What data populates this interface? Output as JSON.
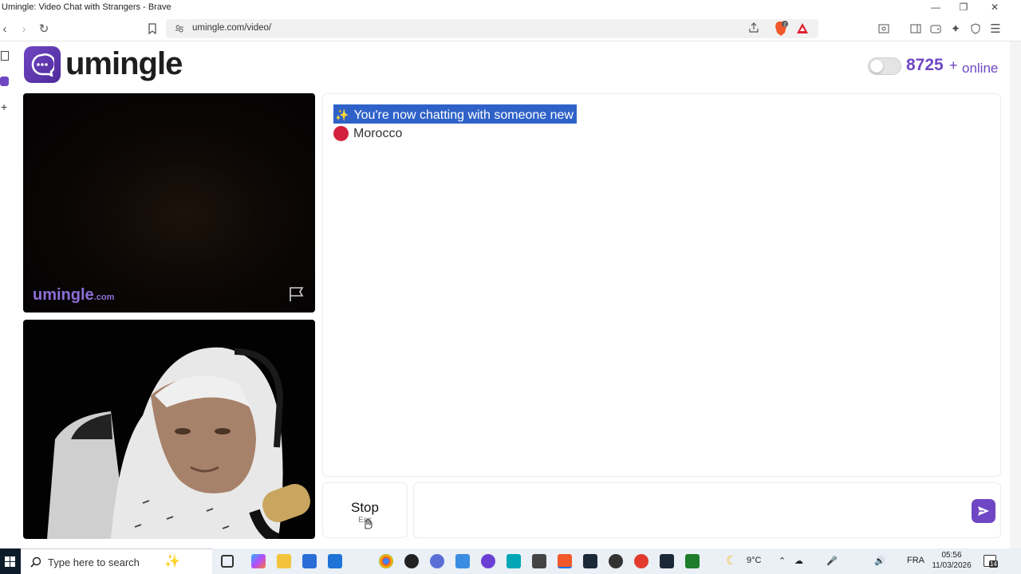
{
  "window": {
    "title": "Umingle: Video Chat with Strangers - Brave"
  },
  "browser": {
    "url": "umingle.com/video/",
    "shield_count": "2"
  },
  "header": {
    "brand": "umingle",
    "online_count": "8725",
    "online_plus": "+",
    "online_label": "online"
  },
  "video": {
    "watermark_main": "umingle",
    "watermark_suffix": ".com"
  },
  "chat": {
    "system_message": "You're now chatting with someone new",
    "country": "Morocco"
  },
  "controls": {
    "stop_label": "Stop",
    "stop_key": "Esc",
    "message_placeholder": ""
  },
  "taskbar": {
    "search_placeholder": "Type here to search",
    "weather": "9°C",
    "language": "FRA",
    "time": "05:56",
    "date": "11/03/2026",
    "notifications": "14"
  },
  "colors": {
    "brand_purple": "#6f47c4",
    "selection_blue": "#2f62c9",
    "country_dot": "#d3213d"
  }
}
